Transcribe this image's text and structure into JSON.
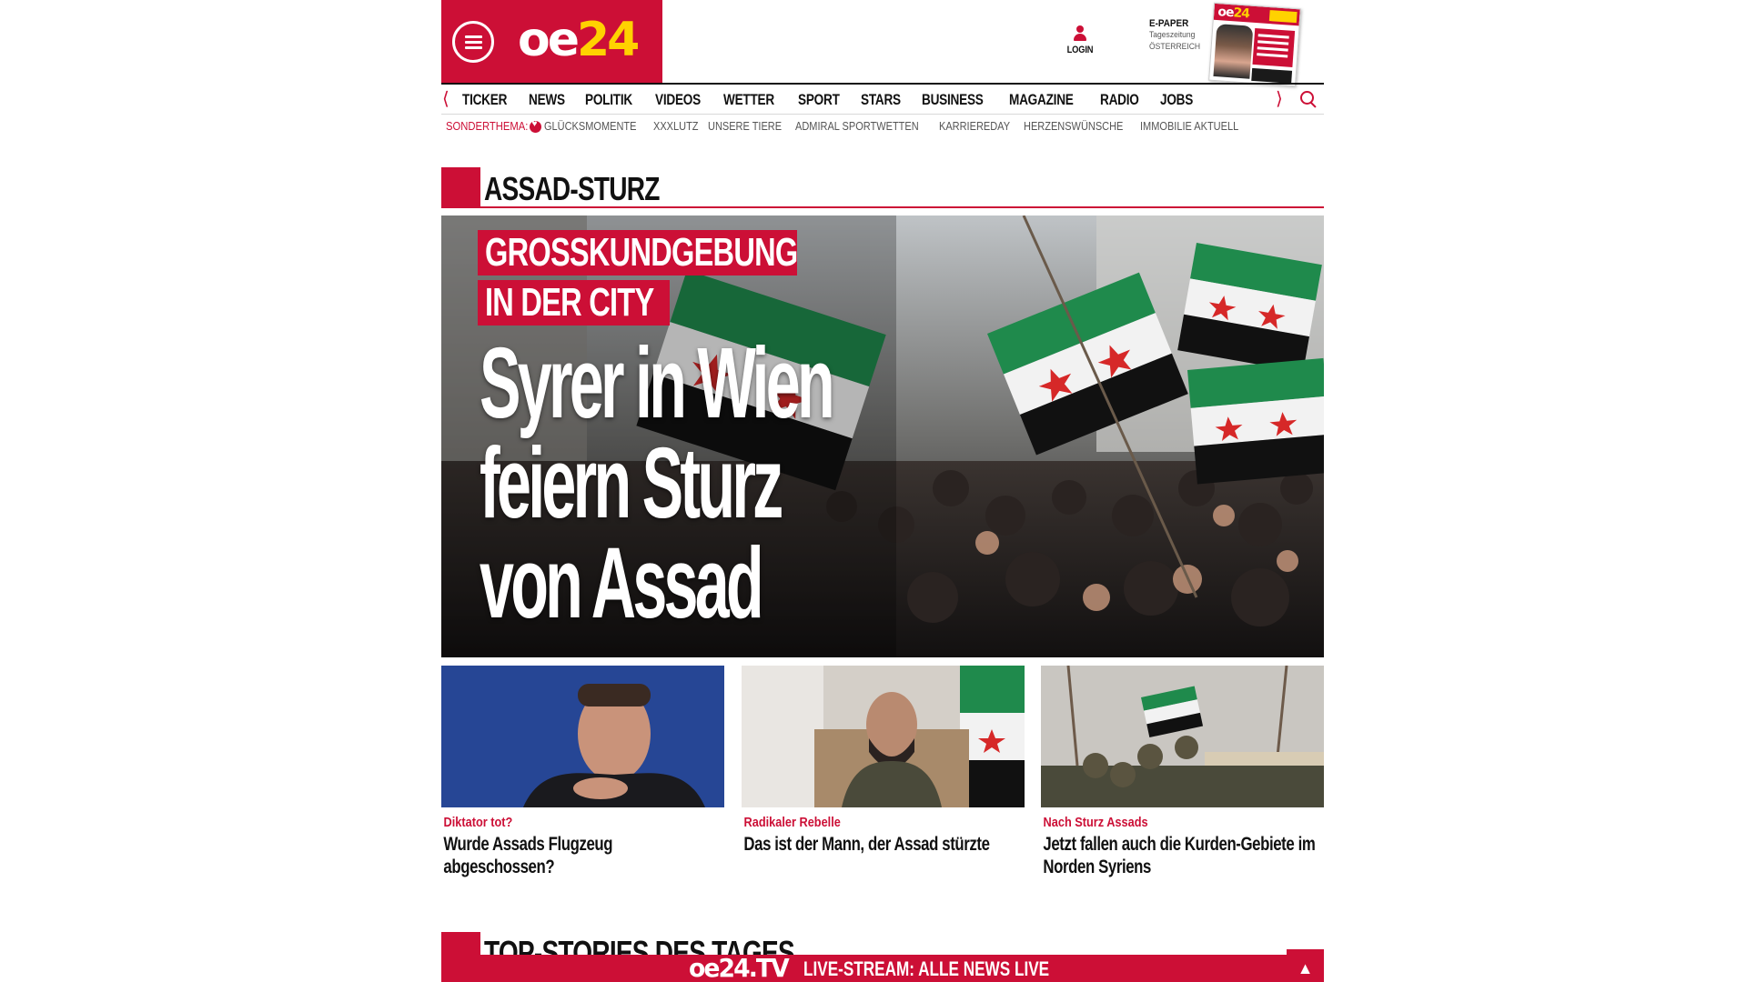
{
  "brand": {
    "logo_oe": "oe",
    "logo_24": "24",
    "color_red": "#cc0f36",
    "color_yellow": "#ffd200"
  },
  "header": {
    "login_label": "LOGIN",
    "epaper_title": "E-PAPER",
    "epaper_sub1": "Tageszeitung",
    "epaper_sub2": "ÖSTERREICH"
  },
  "nav": {
    "items": [
      "TICKER",
      "NEWS",
      "POLITIK",
      "VIDEOS",
      "WETTER",
      "SPORT",
      "STARS",
      "BUSINESS",
      "MAGAZINE",
      "RADIO",
      "JOBS"
    ]
  },
  "subnav": {
    "lead": "SONDERTHEMA:",
    "items": [
      "GLÜCKSMOMENTE",
      "XXXLUTZ",
      "UNSERE TIERE",
      "ADMIRAL SPORTWETTEN",
      "KARRIEREDAY",
      "HERZENSWÜNSCHE",
      "IMMOBILIE AKTUELL"
    ]
  },
  "section": {
    "title": "ASSAD-STURZ"
  },
  "hero": {
    "kicker_line1": "GROSSKUNDGEBUNG",
    "kicker_line2": "IN DER CITY",
    "headline_line1": "Syrer in Wien",
    "headline_line2": "feiern Sturz",
    "headline_line3": "von Assad"
  },
  "teasers": [
    {
      "kicker": "Diktator tot?",
      "headline": "Wurde Assads Flugzeug abgeschossen?"
    },
    {
      "kicker": "Radikaler Rebelle",
      "headline": "Das ist der Mann, der Assad stürzte"
    },
    {
      "kicker": "Nach Sturz Assads",
      "headline": "Jetzt fallen auch die Kurden-Gebiete im Norden Syriens"
    }
  ],
  "section2": {
    "title": "TOP-STORIES DES TAGES"
  },
  "tvbar": {
    "logo": "oe24.TV",
    "text": "LIVE-STREAM: ALLE NEWS LIVE",
    "up_arrow": "▲"
  },
  "icons": [
    "menu-icon",
    "person-icon",
    "search-icon",
    "chevron-left-icon",
    "chevron-right-icon",
    "heart-icon",
    "arrow-up-icon"
  ]
}
